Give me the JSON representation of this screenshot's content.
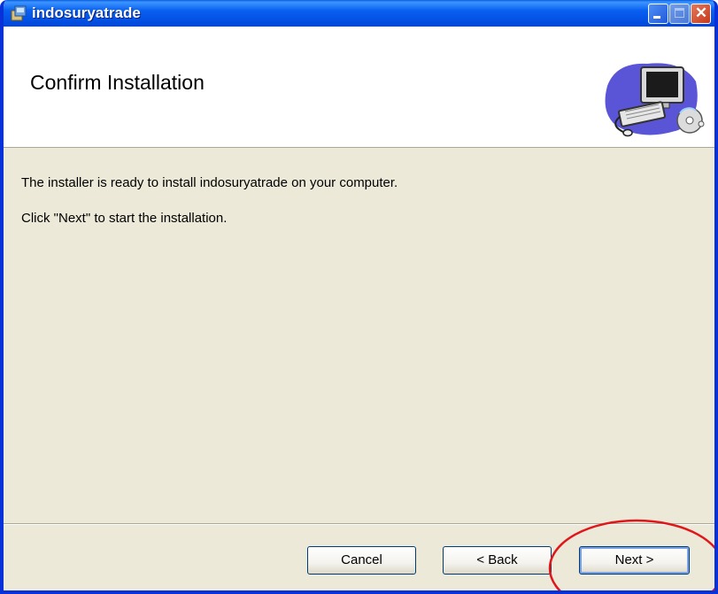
{
  "window": {
    "title": "indosuryatrade",
    "title_icon": "installer-package-icon",
    "controls": [
      "minimize-icon",
      "maximize-icon",
      "close-icon"
    ]
  },
  "banner": {
    "heading": "Confirm Installation",
    "icon": "computer-with-cd-icon"
  },
  "content": {
    "line1": "The installer is ready to install indosuryatrade on your computer.",
    "line2": "Click \"Next\" to start the installation."
  },
  "buttons": {
    "cancel": "Cancel",
    "back": "< Back",
    "next": "Next >"
  },
  "colors": {
    "titlebar": "#0553e8",
    "dialog_bg": "#ece9d8",
    "annotation": "#e0161b"
  }
}
